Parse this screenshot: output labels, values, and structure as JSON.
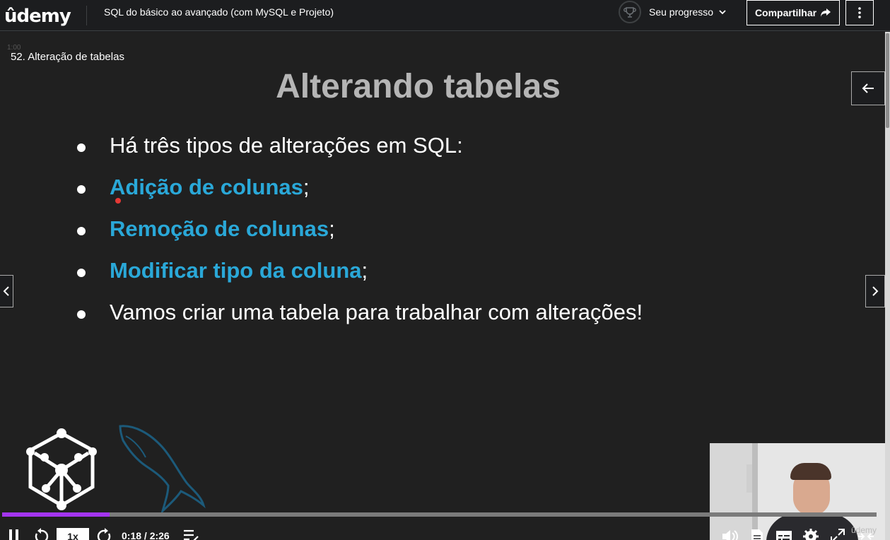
{
  "header": {
    "logo_text": "ûdemy",
    "course_title": "SQL do básico ao avançado (com MySQL e Projeto)",
    "progress_label": "Seu progresso",
    "share_label": "Compartilhar"
  },
  "player": {
    "lecture_title": "52. Alteração de tabelas",
    "ghost_time": "1:00",
    "slide": {
      "title": "Alterando tabelas",
      "bullets": [
        {
          "highlight": "",
          "text": "Há três tipos de alterações em SQL:"
        },
        {
          "highlight": "Adição de colunas",
          "text": ";"
        },
        {
          "highlight": "Remoção de colunas",
          "text": ";"
        },
        {
          "highlight": "Modificar tipo da coluna",
          "text": ";"
        },
        {
          "highlight": "",
          "text": "Vamos criar uma tabela para trabalhar com alterações!"
        }
      ]
    },
    "webcam_watermark": "ûdemy",
    "controls": {
      "speed": "1x",
      "time": "0:18 / 2:26",
      "progress_fraction": 0.123
    }
  },
  "colors": {
    "accent": "#a435f0",
    "highlight_text": "#2aa8d8",
    "background": "#1c1d1f"
  },
  "icons": [
    "udemy-hat-icon",
    "trophy-icon",
    "chevron-down-icon",
    "share-arrow-icon",
    "more-vertical-icon",
    "arrow-left-icon",
    "chevron-left-icon",
    "chevron-right-icon",
    "pause-icon",
    "rewind-icon",
    "forward-icon",
    "notes-icon",
    "volume-icon",
    "transcript-icon",
    "captions-icon",
    "settings-icon",
    "fullscreen-icon",
    "collapse-icon"
  ]
}
